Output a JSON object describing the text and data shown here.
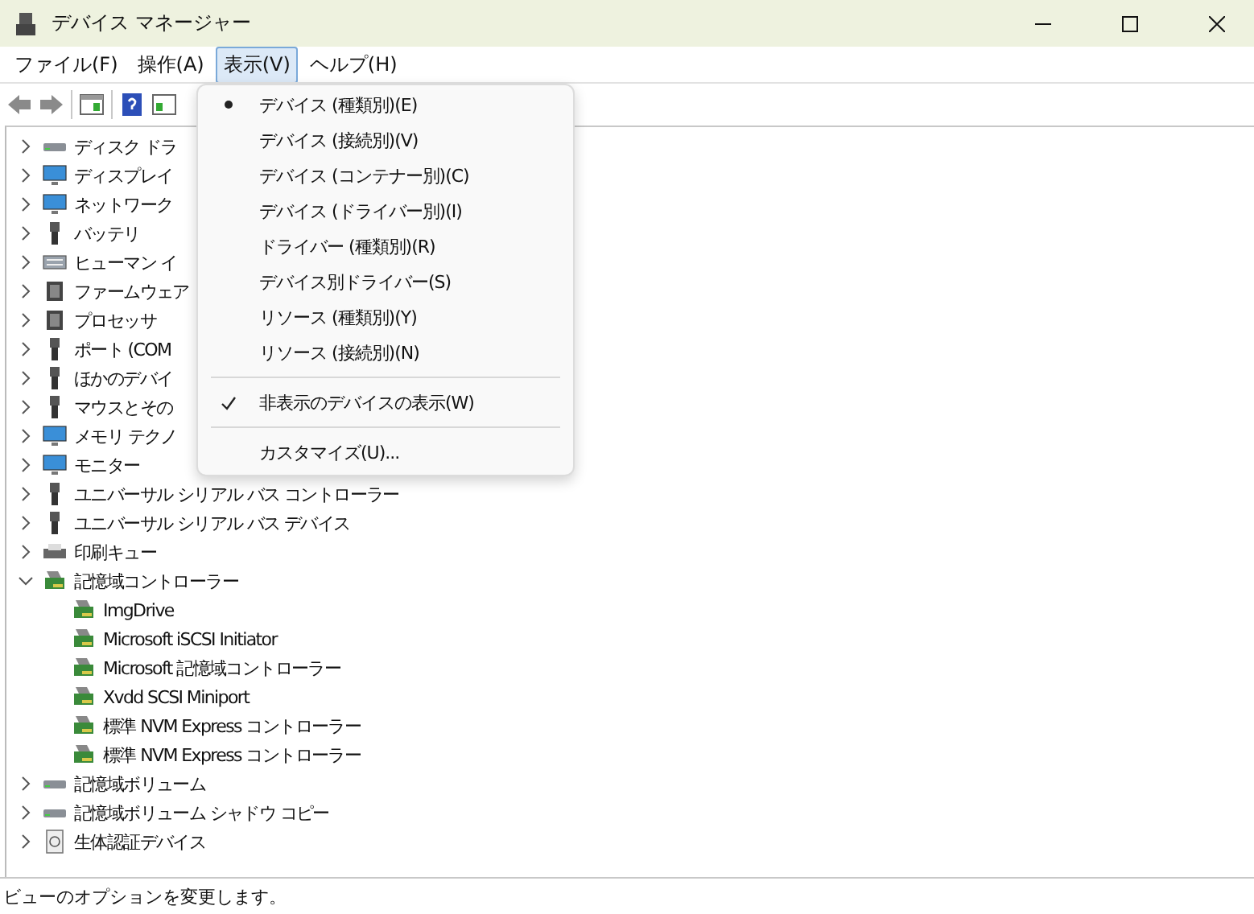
{
  "window": {
    "title": "デバイス マネージャー"
  },
  "menu_bar": [
    {
      "label": "ファイル(F)",
      "selected": false
    },
    {
      "label": "操作(A)",
      "selected": false
    },
    {
      "label": "表示(V)",
      "selected": true
    },
    {
      "label": "ヘルプ(H)",
      "selected": false
    }
  ],
  "tree": [
    {
      "label": "ディスク ドラ",
      "expanded": false
    },
    {
      "label": "ディスプレイ",
      "expanded": false
    },
    {
      "label": "ネットワーク",
      "expanded": false
    },
    {
      "label": "バッテリ",
      "expanded": false
    },
    {
      "label": "ヒューマン イ",
      "expanded": false
    },
    {
      "label": "ファームウェア",
      "expanded": false
    },
    {
      "label": "プロセッサ",
      "expanded": false
    },
    {
      "label": "ポート (COM",
      "expanded": false
    },
    {
      "label": "ほかのデバイ",
      "expanded": false
    },
    {
      "label": "マウスとその",
      "expanded": false
    },
    {
      "label": "メモリ テクノ",
      "expanded": false
    },
    {
      "label": "モニター",
      "expanded": false
    },
    {
      "label": "ユニバーサル シリアル バス コントローラー",
      "expanded": false
    },
    {
      "label": "ユニバーサル シリアル バス デバイス",
      "expanded": false
    },
    {
      "label": "印刷キュー",
      "expanded": false
    },
    {
      "label": "記憶域コントローラー",
      "expanded": true,
      "children": [
        {
          "label": "ImgDrive"
        },
        {
          "label": "Microsoft iSCSI Initiator"
        },
        {
          "label": "Microsoft 記憶域コントローラー"
        },
        {
          "label": "Xvdd SCSI Miniport"
        },
        {
          "label": "標準 NVM Express コントローラー"
        },
        {
          "label": "標準 NVM Express コントローラー"
        }
      ]
    },
    {
      "label": "記憶域ボリューム",
      "expanded": false
    },
    {
      "label": "記憶域ボリューム シャドウ コピー",
      "expanded": false
    },
    {
      "label": "生体認証デバイス",
      "expanded": false
    }
  ],
  "view_menu": [
    {
      "kind": "radio",
      "label": "デバイス (種類別)(E)",
      "selected": true
    },
    {
      "kind": "radio",
      "label": "デバイス (接続別)(V)",
      "selected": false
    },
    {
      "kind": "radio",
      "label": "デバイス (コンテナー別)(C)",
      "selected": false
    },
    {
      "kind": "radio",
      "label": "デバイス (ドライバー別)(I)",
      "selected": false
    },
    {
      "kind": "radio",
      "label": "ドライバー (種類別)(R)",
      "selected": false
    },
    {
      "kind": "radio",
      "label": "デバイス別ドライバー(S)",
      "selected": false
    },
    {
      "kind": "radio",
      "label": "リソース (種類別)(Y)",
      "selected": false
    },
    {
      "kind": "radio",
      "label": "リソース (接続別)(N)",
      "selected": false
    },
    {
      "kind": "separator"
    },
    {
      "kind": "check",
      "label": "非表示のデバイスの表示(W)",
      "checked": true
    },
    {
      "kind": "separator"
    },
    {
      "kind": "plain",
      "label": "カスタマイズ(U)..."
    }
  ],
  "status_bar": "ビューのオプションを変更します。"
}
